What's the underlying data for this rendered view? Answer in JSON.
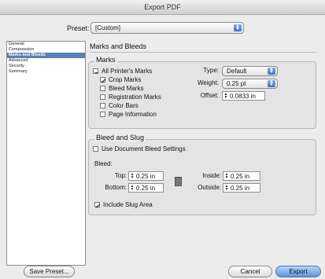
{
  "window": {
    "title": "Export PDF"
  },
  "preset": {
    "label": "Preset:",
    "value": "[Custom]"
  },
  "sidebar": {
    "items": [
      "General",
      "Compression",
      "Marks and Bleeds",
      "Advanced",
      "Security",
      "Summary"
    ],
    "selected": 2
  },
  "section": {
    "title": "Marks and Bleeds"
  },
  "marks": {
    "title": "Marks",
    "all_printers_marks": {
      "label": "All Printer's Marks",
      "state": "mixed"
    },
    "crop_marks": {
      "label": "Crop Marks",
      "checked": true
    },
    "bleed_marks": {
      "label": "Bleed Marks",
      "checked": false
    },
    "registration_marks": {
      "label": "Registration Marks",
      "checked": false
    },
    "color_bars": {
      "label": "Color Bars",
      "checked": false
    },
    "page_information": {
      "label": "Page Information",
      "checked": false
    },
    "type": {
      "label": "Type:",
      "value": "Default"
    },
    "weight": {
      "label": "Weight:",
      "value": "0.25 pt"
    },
    "offset": {
      "label": "Offset:",
      "value": "0.0833 in"
    }
  },
  "bleed_slug": {
    "title": "Bleed and Slug",
    "use_document_bleed": {
      "label": "Use Document Bleed Settings",
      "checked": false
    },
    "bleed_label": "Bleed:",
    "top": {
      "label": "Top:",
      "value": "0.25 in"
    },
    "bottom": {
      "label": "Bottom:",
      "value": "0.25 in"
    },
    "inside": {
      "label": "Inside:",
      "value": "0.25 in"
    },
    "outside": {
      "label": "Outside:",
      "value": "0.25 in"
    },
    "include_slug": {
      "label": "Include Slug Area",
      "checked": true
    }
  },
  "buttons": {
    "save_preset": "Save Preset...",
    "cancel": "Cancel",
    "export": "Export"
  }
}
